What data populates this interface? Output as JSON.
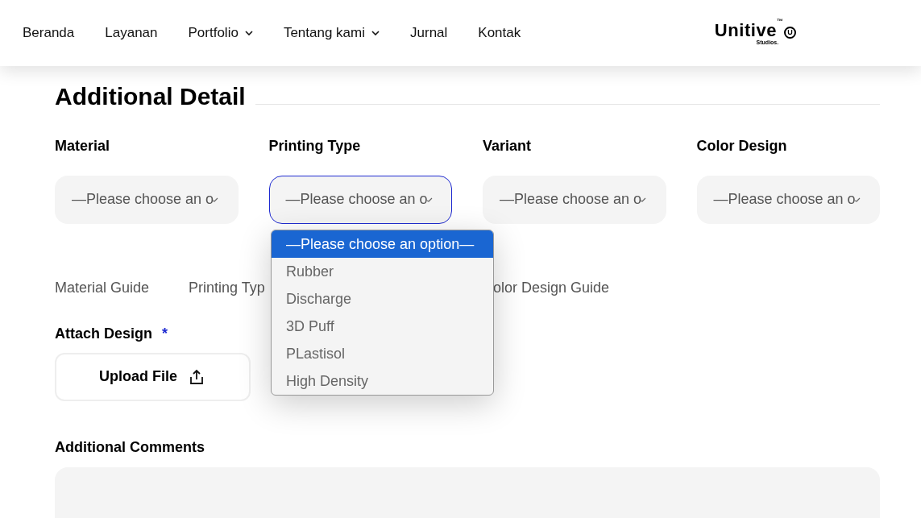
{
  "nav": {
    "items": [
      {
        "label": "Beranda",
        "has_menu": false
      },
      {
        "label": "Layanan",
        "has_menu": false
      },
      {
        "label": "Portfolio",
        "has_menu": true
      },
      {
        "label": "Tentang kami",
        "has_menu": true
      },
      {
        "label": "Jurnal",
        "has_menu": false
      },
      {
        "label": "Kontak",
        "has_menu": false
      }
    ],
    "logo": {
      "name": "Unitive",
      "mark": "™",
      "badge": "U",
      "sub": "Studios."
    }
  },
  "section": {
    "title": "Additional Detail"
  },
  "fields": [
    {
      "label": "Material",
      "value": "—Please choose an o",
      "focused": false
    },
    {
      "label": "Printing Type",
      "value": "—Please choose an o",
      "focused": true
    },
    {
      "label": "Variant",
      "value": "—Please choose an o",
      "focused": false
    },
    {
      "label": "Color Design",
      "value": "—Please choose an o",
      "focused": false
    }
  ],
  "dropdown": {
    "options": [
      {
        "label": "—Please choose an option—",
        "selected": true
      },
      {
        "label": "Rubber",
        "selected": false
      },
      {
        "label": "Discharge",
        "selected": false
      },
      {
        "label": "3D Puff",
        "selected": false
      },
      {
        "label": "PLastisol",
        "selected": false
      },
      {
        "label": "High Density",
        "selected": false
      }
    ]
  },
  "guides": [
    "Material Guide",
    "Printing Typ",
    "olor Design Guide"
  ],
  "attach": {
    "label": "Attach Design",
    "required_mark": "*",
    "button": "Upload File"
  },
  "comments": {
    "label": "Additional Comments"
  }
}
